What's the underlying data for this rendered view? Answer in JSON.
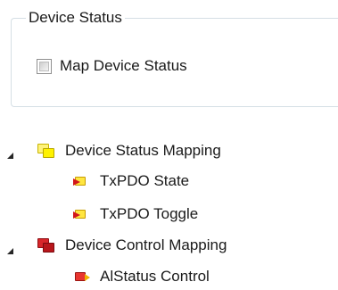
{
  "group": {
    "title": "Device Status",
    "checkbox": {
      "label": "Map Device Status",
      "checked": false
    }
  },
  "tree": {
    "nodes": [
      {
        "label": "Device Status Mapping",
        "expanded": true,
        "icon": "yellow-stack-icon",
        "icon_color": "#fff200",
        "children": [
          {
            "label": "TxPDO State",
            "icon": "tx-entry-icon"
          },
          {
            "label": "TxPDO Toggle",
            "icon": "tx-entry-icon"
          }
        ]
      },
      {
        "label": "Device Control Mapping",
        "expanded": true,
        "icon": "red-stack-icon",
        "icon_color": "#b8161b",
        "children": [
          {
            "label": "AlStatus Control",
            "icon": "rx-entry-icon"
          }
        ]
      }
    ]
  }
}
